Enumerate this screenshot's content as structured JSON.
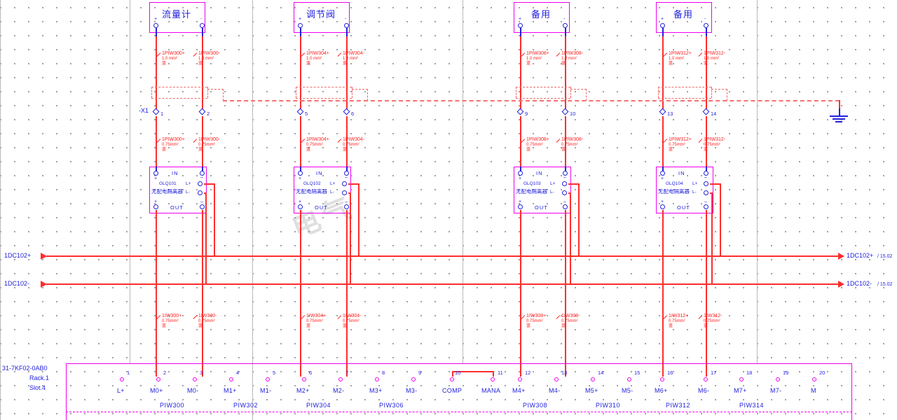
{
  "sheet": {
    "background": "#ffffff",
    "grid_color": "#8a8a8a",
    "wire_color": "#ff2d2d",
    "text_color": "#2222dd",
    "box_color": "#ee00ee",
    "watermark": "电气"
  },
  "devices": [
    {
      "title": "流量计",
      "plus": "+",
      "minus": "-"
    },
    {
      "title": "调节阀",
      "plus": "+",
      "minus": "-"
    },
    {
      "title": "备用",
      "plus": "+",
      "minus": "-"
    },
    {
      "title": "备用",
      "plus": "+",
      "minus": "-"
    }
  ],
  "terminal_strip_top": {
    "tag": "-X1",
    "terminals": [
      "1",
      "2",
      "5",
      "6",
      "9",
      "10",
      "13",
      "14"
    ]
  },
  "upper_wires": [
    {
      "name": "1PIW300+",
      "size": "1.0 mm²",
      "color": "蓝"
    },
    {
      "name": "1PIW300-",
      "size": "1.0 mm²",
      "color": "蓝"
    },
    {
      "name": "1PIW304+",
      "size": "1.0 mm²",
      "color": "蓝"
    },
    {
      "name": "1PIW304-",
      "size": "1.0 mm²",
      "color": "蓝"
    },
    {
      "name": "1PIW308+",
      "size": "1.0 mm²",
      "color": "蓝"
    },
    {
      "name": "1PIW308-",
      "size": "1.0 mm²",
      "color": "蓝"
    },
    {
      "name": "1PIW312+",
      "size": "1.0 mm²",
      "color": "蓝"
    },
    {
      "name": "1PIW312-",
      "size": "1.0 mm²",
      "color": "蓝"
    }
  ],
  "mid_wires": [
    {
      "name": "1PIW300+",
      "size": "0.75mm²",
      "color": "蓝"
    },
    {
      "name": "1PIW300-",
      "size": "0.75mm²",
      "color": "蓝"
    },
    {
      "name": "1PIW304+",
      "size": "0.75mm²",
      "color": "蓝"
    },
    {
      "name": "1PIW304-",
      "size": "0.75mm²",
      "color": "蓝"
    },
    {
      "name": "1PIW308+",
      "size": "0.75mm²",
      "color": "蓝"
    },
    {
      "name": "1PIW308-",
      "size": "0.75mm²",
      "color": "蓝"
    },
    {
      "name": "1PIW312+",
      "size": "0.75mm²",
      "color": "蓝"
    },
    {
      "name": "1PIW312-",
      "size": "0.75mm²",
      "color": "蓝"
    }
  ],
  "lower_wires": [
    {
      "name": "1IW300+",
      "size": "0.75mm²",
      "color": "蓝"
    },
    {
      "name": "1IW300-",
      "size": "0.75mm²",
      "color": "蓝"
    },
    {
      "name": "1IW304+",
      "size": "0.75mm²",
      "color": "蓝"
    },
    {
      "name": "1IW304-",
      "size": "0.75mm²",
      "color": "蓝"
    },
    {
      "name": "1IW308+",
      "size": "0.75mm²",
      "color": "蓝"
    },
    {
      "name": "1IW308-",
      "size": "0.75mm²",
      "color": "蓝"
    },
    {
      "name": "1IW312+",
      "size": "0.75mm²",
      "color": "蓝"
    },
    {
      "name": "1IW312-",
      "size": "0.75mm²",
      "color": "蓝"
    }
  ],
  "isolators": [
    {
      "tag": "GLQ101",
      "name": "无配电隔离器",
      "in": "IN",
      "out": "OUT",
      "lplus": "L+",
      "lminus": "L-"
    },
    {
      "tag": "GLQ102",
      "name": "无配电隔离器",
      "in": "IN",
      "out": "OUT",
      "lplus": "L+",
      "lminus": "L-"
    },
    {
      "tag": "GLQ103",
      "name": "无配电隔离器",
      "in": "IN",
      "out": "OUT",
      "lplus": "L+",
      "lminus": "L-"
    },
    {
      "tag": "GLQ104",
      "name": "无配电隔离器",
      "in": "IN",
      "out": "OUT",
      "lplus": "L+",
      "lminus": "L-"
    }
  ],
  "power_rails": [
    {
      "left_label": "1DC102+",
      "right_label": "1DC102+",
      "xref": "/ 15.02"
    },
    {
      "left_label": "1DC102-",
      "right_label": "1DC102-",
      "xref": "/ 15.02"
    }
  ],
  "plc": {
    "order_no": "31-7KF02-0AB0",
    "rack": "Rack.1",
    "slot": "Slot.4",
    "terminals": [
      {
        "no": "1",
        "mark": "L+"
      },
      {
        "no": "2",
        "mark": "M0+"
      },
      {
        "no": "3",
        "mark": "M0-"
      },
      {
        "no": "4",
        "mark": "M1+"
      },
      {
        "no": "5",
        "mark": "M1-"
      },
      {
        "no": "6",
        "mark": "M2+"
      },
      {
        "no": "7",
        "mark": "M2-"
      },
      {
        "no": "8",
        "mark": "M3+"
      },
      {
        "no": "9",
        "mark": "M3-"
      },
      {
        "no": "10",
        "mark": "COMP"
      },
      {
        "no": "11",
        "mark": "MANA"
      },
      {
        "no": "12",
        "mark": "M4+"
      },
      {
        "no": "13",
        "mark": "M4-"
      },
      {
        "no": "14",
        "mark": "M5+"
      },
      {
        "no": "15",
        "mark": "M5-"
      },
      {
        "no": "16",
        "mark": "M6+"
      },
      {
        "no": "17",
        "mark": "M6-"
      },
      {
        "no": "18",
        "mark": "M7+"
      },
      {
        "no": "19",
        "mark": "M7-"
      },
      {
        "no": "20",
        "mark": "M"
      }
    ],
    "channels": [
      "PIW300",
      "PIW302",
      "PIW304",
      "PIW306",
      "PIW308",
      "PIW310",
      "PIW312",
      "PIW314"
    ]
  }
}
